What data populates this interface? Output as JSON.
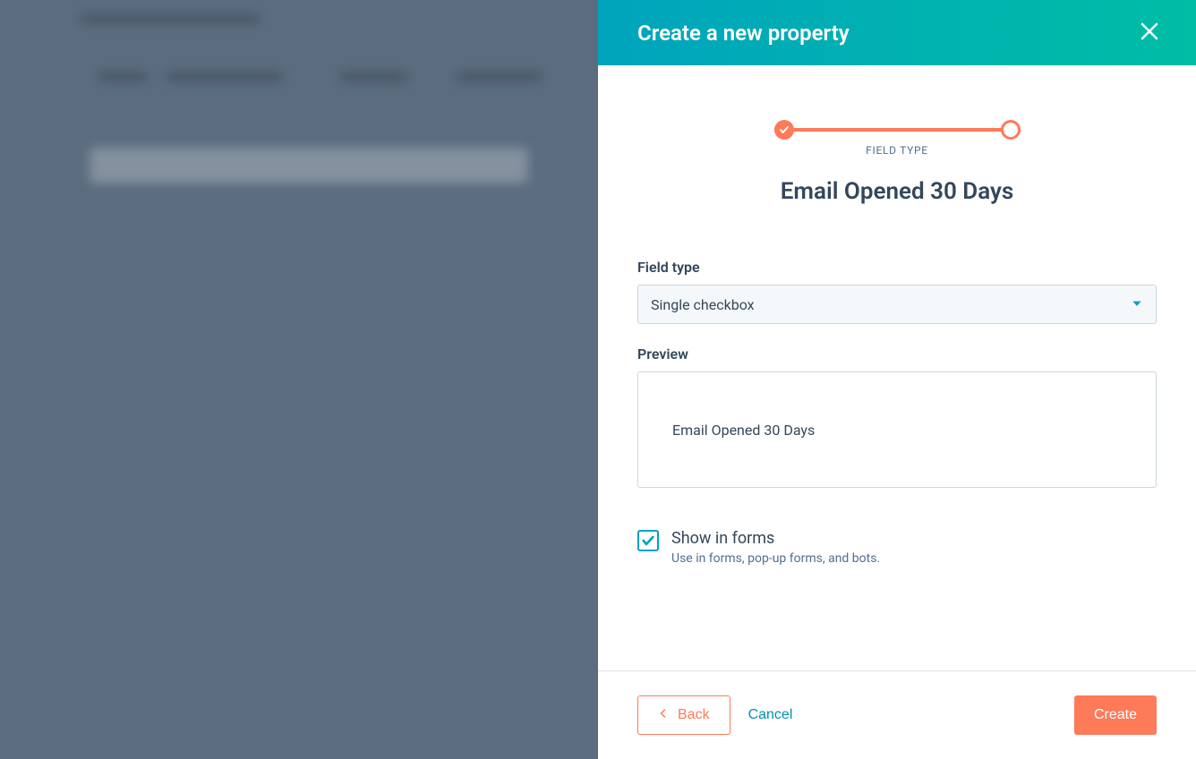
{
  "panel": {
    "title": "Create a new property",
    "progress": {
      "label": "FIELD TYPE",
      "property_name": "Email Opened 30 Days"
    },
    "field_type": {
      "label": "Field type",
      "selected": "Single checkbox"
    },
    "preview": {
      "label": "Preview",
      "text": "Email Opened 30 Days"
    },
    "show_in_forms": {
      "label": "Show in forms",
      "description": "Use in forms, pop-up forms, and bots.",
      "checked": true
    },
    "footer": {
      "back": "Back",
      "cancel": "Cancel",
      "create": "Create"
    }
  }
}
